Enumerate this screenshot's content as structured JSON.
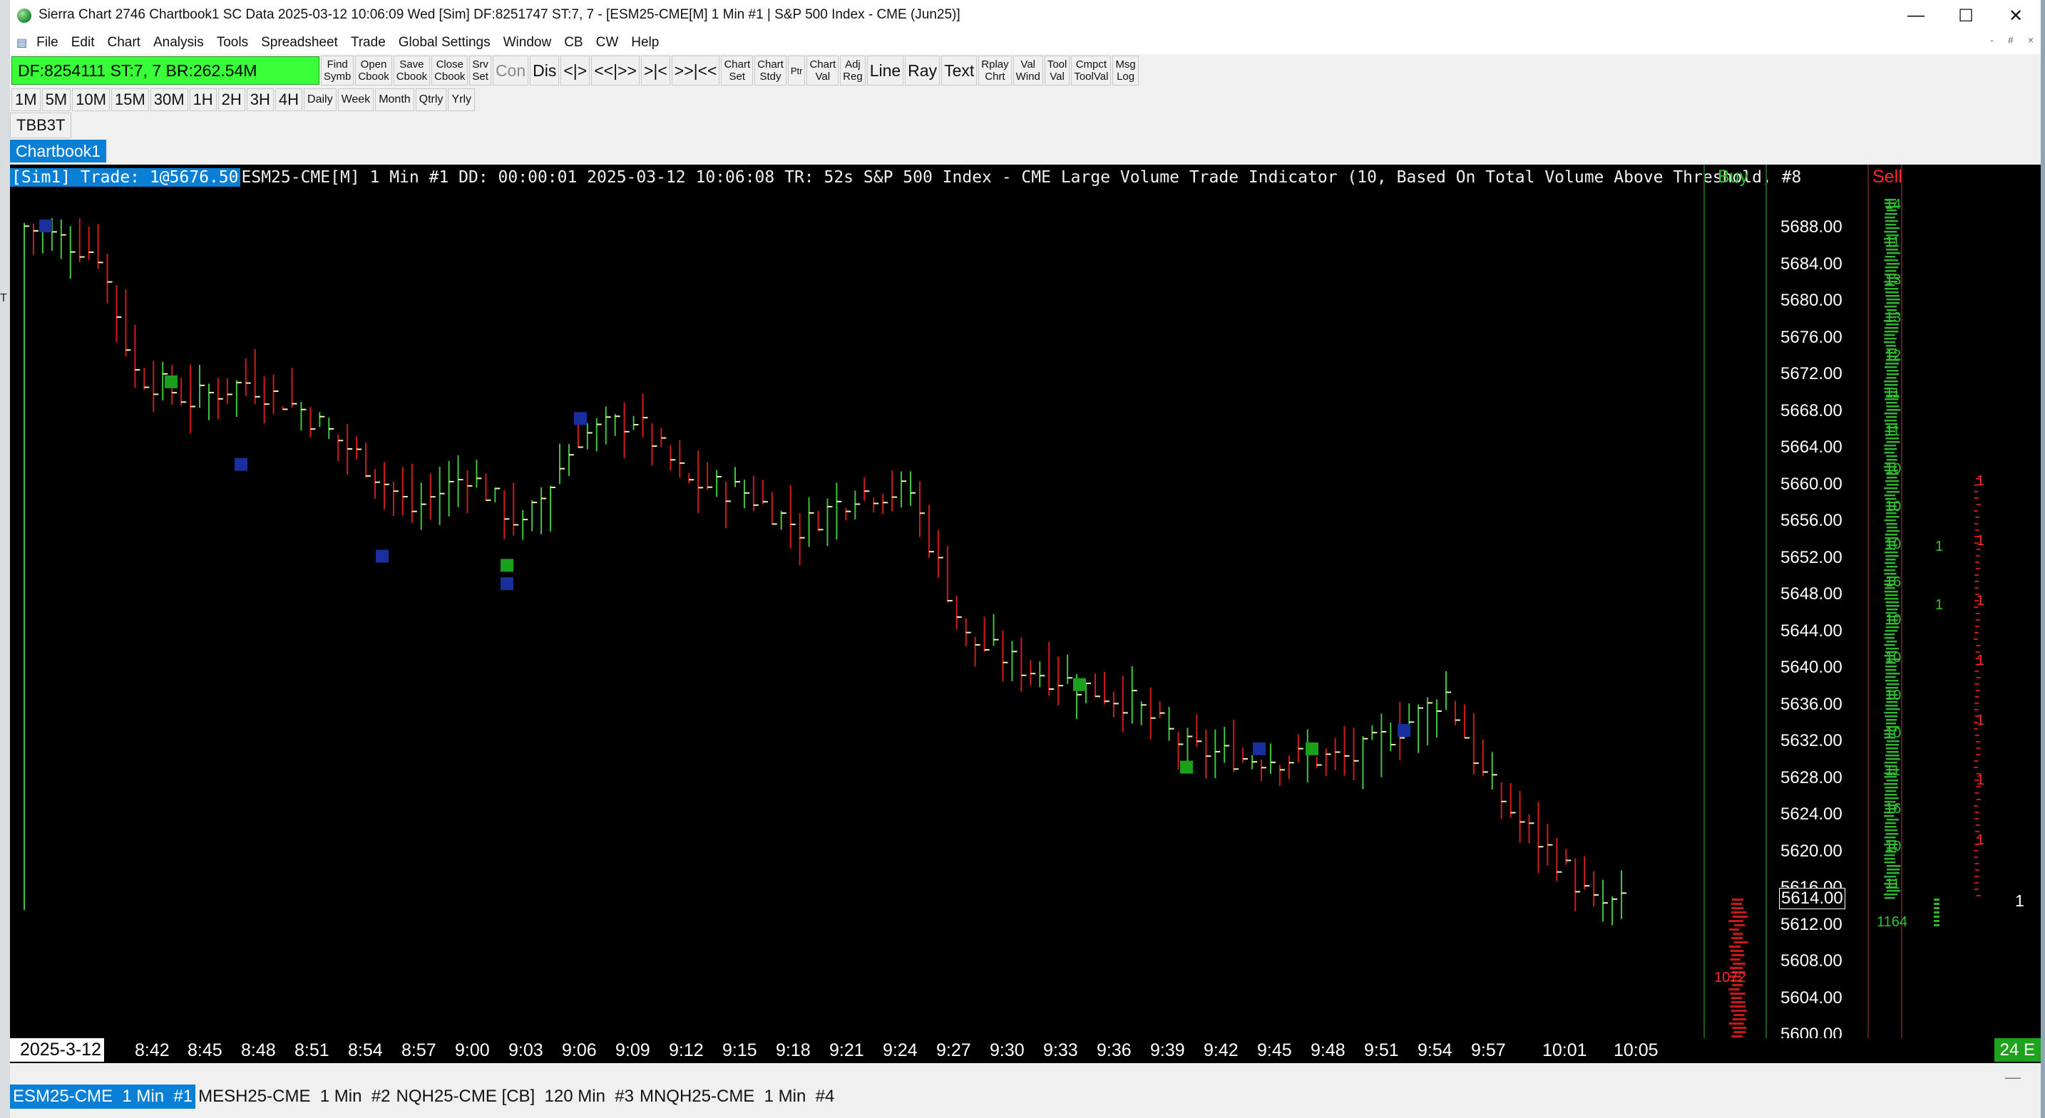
{
  "window": {
    "title": "Sierra Chart 2746 Chartbook1 SC Data 2025-03-12  10:06:09 Wed [Sim] DF:8251747  ST:7, 7 - [ESM25-CME[M]  1 Min  #1 | S&P 500 Index - CME (Jun25)]",
    "minimize": "—",
    "maximize": "☐",
    "close": "✕"
  },
  "menu": [
    "File",
    "Edit",
    "Chart",
    "Analysis",
    "Tools",
    "Spreadsheet",
    "Trade",
    "Global Settings",
    "Window",
    "CB",
    "CW",
    "Help"
  ],
  "mdi_controls": [
    "-",
    "#",
    "×"
  ],
  "status_box": "DF:8254111   ST:7, 7    BR:262.54M",
  "toolbar": [
    {
      "label": "Find\nSymb"
    },
    {
      "label": "Open\nCbook"
    },
    {
      "label": "Save\nCbook"
    },
    {
      "label": "Close\nCbook"
    },
    {
      "label": "Srv\nSet"
    },
    {
      "label": "Con",
      "style": "big gray"
    },
    {
      "label": "Dis",
      "style": "big"
    },
    {
      "label": "<|>",
      "style": "big"
    },
    {
      "label": "<<|>>",
      "style": "big"
    },
    {
      "label": ">|<",
      "style": "big"
    },
    {
      "label": ">>|<<",
      "style": "big"
    },
    {
      "label": "Chart\nSet"
    },
    {
      "label": "Chart\nStdy"
    },
    {
      "label": "Ptr",
      "style": "small"
    },
    {
      "label": "Chart\nVal"
    },
    {
      "label": "Adj\nReg"
    },
    {
      "label": "Line",
      "style": "big"
    },
    {
      "label": "Ray",
      "style": "big"
    },
    {
      "label": "Text",
      "style": "big"
    },
    {
      "label": "Rplay\nChrt"
    },
    {
      "label": "Val\nWind"
    },
    {
      "label": "Tool\nVal"
    },
    {
      "label": "Cmpct\nToolVal"
    },
    {
      "label": "Msg\nLog"
    }
  ],
  "timeframes": [
    {
      "label": "1M"
    },
    {
      "label": "5M"
    },
    {
      "label": "10M"
    },
    {
      "label": "15M"
    },
    {
      "label": "30M"
    },
    {
      "label": "1H"
    },
    {
      "label": "2H"
    },
    {
      "label": "3H"
    },
    {
      "label": "4H"
    },
    {
      "label": "Daily",
      "s": true
    },
    {
      "label": "Week",
      "s": true
    },
    {
      "label": "Month",
      "s": true
    },
    {
      "label": "Qtrly",
      "s": true
    },
    {
      "label": "Yrly",
      "s": true
    }
  ],
  "tbb_button": "TBB3T",
  "chartbook_tab": "Chartbook1",
  "chart_header": {
    "sim": "[Sim1]  Trade: 1@5676.50",
    "rest": "ESM25-CME[M]  1 Min  #1 DD: 00:00:01 2025-03-12 10:06:08 TR: 52s S&P 500 Index - CME Large Volume Trade Indicator  (10, Based On Total Volume Above Threshold, #8"
  },
  "buy_label": "Buy",
  "sell_label": "Sell",
  "price_axis": [
    "5688.00",
    "5684.00",
    "5680.00",
    "5676.00",
    "5672.00",
    "5668.00",
    "5664.00",
    "5660.00",
    "5656.00",
    "5652.00",
    "5648.00",
    "5644.00",
    "5640.00",
    "5636.00",
    "5632.00",
    "5628.00",
    "5624.00",
    "5620.00",
    "5616.00",
    "5612.00",
    "5608.00",
    "5604.00",
    "5600.00"
  ],
  "current_price": "5614.00",
  "time_axis": {
    "date": "2025-3-12",
    "labels": [
      "8:42",
      "8:45",
      "8:48",
      "8:51",
      "8:54",
      "8:57",
      "9:00",
      "9:03",
      "9:06",
      "9:09",
      "9:12",
      "9:15",
      "9:18",
      "9:21",
      "9:24",
      "9:27",
      "9:30",
      "9:33",
      "9:36",
      "9:39",
      "9:42",
      "9:45",
      "9:48",
      "9:51",
      "9:54",
      "9:57",
      "10:01",
      "10:05"
    ],
    "right_badge": "24 E"
  },
  "volume_values": {
    "buy_bottom": "1072",
    "sell_column": [
      "14",
      "11",
      "13",
      "13",
      "12",
      "11",
      "11",
      "10",
      "10",
      "10",
      "16",
      "10",
      "10",
      "10",
      "10",
      "11",
      "16",
      "10",
      "11",
      "1164"
    ],
    "buy_side": [
      "1",
      "1"
    ],
    "sell_side": [
      "1",
      "1",
      "1",
      "1",
      "1",
      "1",
      "1"
    ],
    "right_edge": "1"
  },
  "bottom_tabs": [
    {
      "label": "ESM25-CME  1 Min  #1",
      "active": true
    },
    {
      "label": "MESH25-CME  1 Min  #2"
    },
    {
      "label": "NQH25-CME [CB]  120 Min  #3"
    },
    {
      "label": "MNQH25-CME  1 Min  #4"
    }
  ],
  "bottom_scroll": "—",
  "colors": {
    "up_bar": "#3fc43f",
    "down_bar": "#d01b1b",
    "close_tick": "#f3f3b0",
    "buy_marker": "#1aa01a",
    "sell_marker": "#1a2f9e",
    "accent": "#0a7fd6",
    "status_green": "#39ff39"
  }
}
